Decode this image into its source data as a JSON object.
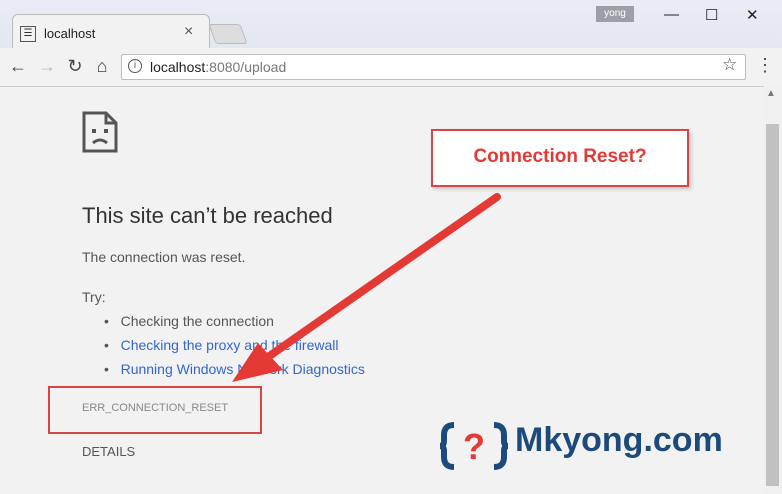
{
  "window": {
    "user": "yong",
    "minimize": "—",
    "maximize": "☐",
    "close": "✕"
  },
  "tab": {
    "title": "localhost",
    "favicon": "☰",
    "close": "×"
  },
  "toolbar": {
    "back": "←",
    "forward": "→",
    "reload": "↻",
    "home": "⌂",
    "url_host": "localhost",
    "url_rest": ":8080/upload",
    "star": "☆",
    "menu": "⋮"
  },
  "error": {
    "title": "This site can’t be reached",
    "message": "The connection was reset.",
    "try_label": "Try:",
    "suggestions": [
      {
        "text": "Checking the connection",
        "link": false
      },
      {
        "text": "Checking the proxy and the firewall",
        "link": true
      },
      {
        "text": "Running Windows Network Diagnostics",
        "link": true
      }
    ],
    "code": "ERR_CONNECTION_RESET",
    "details": "DETAILS"
  },
  "annotation": {
    "callout": "Connection Reset?"
  },
  "logo": {
    "text": "Mkyong.com",
    "mark": "{?}"
  },
  "colors": {
    "link": "#3366cc",
    "annotation": "#e53935",
    "logo": "#1c4a7a"
  }
}
